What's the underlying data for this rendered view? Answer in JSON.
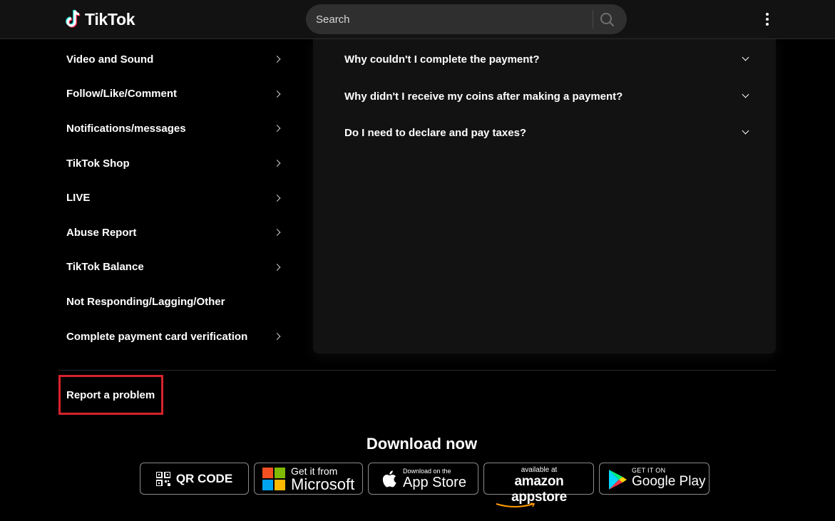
{
  "header": {
    "logo_text": "TikTok",
    "search_placeholder": "Search"
  },
  "sidebar": {
    "items": [
      {
        "label": "Video and Sound",
        "has_chevron": true
      },
      {
        "label": "Follow/Like/Comment",
        "has_chevron": true
      },
      {
        "label": "Notifications/messages",
        "has_chevron": true
      },
      {
        "label": "TikTok Shop",
        "has_chevron": true
      },
      {
        "label": "LIVE",
        "has_chevron": true
      },
      {
        "label": "Abuse Report",
        "has_chevron": true
      },
      {
        "label": "TikTok Balance",
        "has_chevron": true
      },
      {
        "label": "Not Responding/Lagging/Other",
        "has_chevron": false
      },
      {
        "label": "Complete payment card verification",
        "has_chevron": true
      }
    ]
  },
  "faq": {
    "questions": [
      "Why couldn't I complete the payment?",
      "Why didn't I receive my coins after making a payment?",
      "Do I need to declare and pay taxes?"
    ]
  },
  "report_link": "Report a problem",
  "download": {
    "title": "Download now",
    "qr_label": "QR CODE",
    "microsoft": {
      "small": "Get it from",
      "big": "Microsoft"
    },
    "apple": {
      "small": "Download on the",
      "big": "App Store"
    },
    "amazon": {
      "small": "available at",
      "big": "amazon appstore"
    },
    "google": {
      "small": "GET IT ON",
      "big": "Google Play"
    }
  },
  "colors": {
    "background": "#000000",
    "header_bg": "#121212",
    "panel_bg": "#121212",
    "search_bg": "#2f2f2f",
    "highlight_border": "#d6232c",
    "tiktok_cyan": "#25f4ee",
    "tiktok_red": "#fe2c55"
  },
  "icons": {
    "search": "magnifier-icon",
    "menu": "kebab-menu-icon",
    "chevron_right": "chevron-right-icon",
    "chevron_down": "chevron-down-icon"
  }
}
